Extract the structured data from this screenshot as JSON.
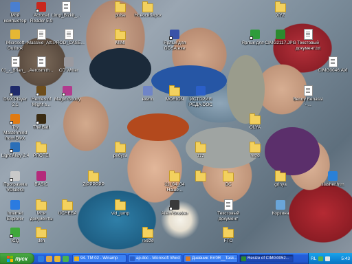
{
  "desktop": {
    "icons": [
      {
        "key": "my_computer",
        "label": "Мой компьютер",
        "kind": "app",
        "color": "#4a7fd0",
        "shortcut": false
      },
      {
        "key": "acrobat",
        "label": "Acrobat Reader 5.0",
        "kind": "app",
        "color": "#c8281e",
        "shortcut": true
      },
      {
        "key": "limp",
        "label": "Limp_Bizkit_...",
        "kind": "doc",
        "color": "#ffffff",
        "shortcut": false
      },
      {
        "key": "pulse",
        "label": "pulse",
        "kind": "folder",
        "color": "#f3d15e",
        "shortcut": false
      },
      {
        "key": "novosibirsk",
        "label": "Новосибирск",
        "kind": "folder",
        "color": "#f3d15e",
        "shortcut": false
      },
      {
        "key": "xyz",
        "label": "XYZ",
        "kind": "folder",
        "color": "#f3d15e",
        "shortcut": false
      },
      {
        "key": "outlook",
        "label": "Microsoft Outlook",
        "kind": "app",
        "color": "#e6b734",
        "shortcut": false
      },
      {
        "key": "massive",
        "label": "Massive_Att...",
        "kind": "doc",
        "color": "#ffffff",
        "shortcut": false
      },
      {
        "key": "prod2",
        "label": "PROD_CASE...",
        "kind": "doc",
        "color": "#ffffff",
        "shortcut": false
      },
      {
        "key": "mimi",
        "label": "MIMI",
        "kind": "folder",
        "color": "#f3d15e",
        "shortcut": false
      },
      {
        "key": "ddsa",
        "label": "Ярлык для DDSA.exe",
        "kind": "app",
        "color": "#3a53a8",
        "shortcut": true
      },
      {
        "key": "shortcut_rus",
        "label": "Ярлык для ...",
        "kind": "app",
        "color": "#2f9c3a",
        "shortcut": true
      },
      {
        "key": "cimg2117",
        "label": "CIMG2117.JPG",
        "kind": "app",
        "color": "#2b8a2e",
        "shortcut": false
      },
      {
        "key": "textdoc",
        "label": "Текстовый документ.txt",
        "kind": "doc",
        "color": "#ffffff",
        "shortcut": false
      },
      {
        "key": "brian",
        "label": "01_-_Brian_...",
        "kind": "doc",
        "color": "#ffffff",
        "shortcut": false
      },
      {
        "key": "aerosmith",
        "label": "Aerosmith...",
        "kind": "doc",
        "color": "#ffffff",
        "shortcut": false
      },
      {
        "key": "cdwriter",
        "label": "CD Writer",
        "kind": "app",
        "color": "#9a9aa0",
        "shortcut": false
      },
      {
        "key": "cimg0046",
        "label": "CIMG0046.AVI",
        "kind": "doc",
        "color": "#ffffff",
        "shortcut": false
      },
      {
        "key": "divxplayer",
        "label": "DivX Player 2.1",
        "kind": "app",
        "color": "#1f2a6a",
        "shortcut": true
      },
      {
        "key": "heroes",
        "label": "Heroes of Might a...",
        "kind": "app",
        "color": "#6e4e1c",
        "shortcut": true
      },
      {
        "key": "magicgoody",
        "label": "Magic Goody",
        "kind": "app",
        "color": "#b23b8e",
        "shortcut": true
      },
      {
        "key": "nkito",
        "label": "нкито",
        "kind": "app",
        "color": "#6f85c7",
        "shortcut": false
      },
      {
        "key": "morion",
        "label": "MORION",
        "kind": "folder",
        "color": "#f3d15e",
        "shortcut": false
      },
      {
        "key": "istoriya",
        "label": "ИСТОРИЯ РЕДА.DOC",
        "kind": "app",
        "color": "#2b5fc8",
        "shortcut": false
      },
      {
        "key": "benny",
        "label": "Benny Benassi - ...",
        "kind": "doc",
        "color": "#ffffff",
        "shortcut": false
      },
      {
        "key": "divx_tmm",
        "label": "Try Mastermind from DivX",
        "kind": "app",
        "color": "#e07a12",
        "shortcut": true
      },
      {
        "key": "thebat",
        "label": "The Bat!",
        "kind": "app",
        "color": "#3a2b12",
        "shortcut": true
      },
      {
        "key": "olya",
        "label": "OLYA",
        "kind": "folder",
        "color": "#f3d15e",
        "shortcut": false
      },
      {
        "key": "lightalloy",
        "label": "Light Alloy 2.4",
        "kind": "app",
        "color": "#2a6fb8",
        "shortcut": true
      },
      {
        "key": "protei",
        "label": "PROTEI",
        "kind": "folder",
        "color": "#f3d15e",
        "shortcut": false
      },
      {
        "key": "rebuha",
        "label": "ребуха",
        "kind": "folder",
        "color": "#f3d15e",
        "shortcut": false
      },
      {
        "key": "zzz",
        "label": "zzz",
        "kind": "folder",
        "color": "#f3d15e",
        "shortcut": false
      },
      {
        "key": "retro",
        "label": "retro",
        "kind": "folder",
        "color": "#f3d15e",
        "shortcut": false
      },
      {
        "key": "vdiaer",
        "label": "Программа VDialer3",
        "kind": "app",
        "color": "#c9c9c9",
        "shortcut": true
      },
      {
        "key": "basic",
        "label": "BASIC",
        "kind": "app",
        "color": "#b42a7a",
        "shortcut": false
      },
      {
        "key": "zippppp",
        "label": "ZIPPPPPP",
        "kind": "folder",
        "color": "#f3d15e",
        "shortcut": false
      },
      {
        "key": "nashe",
        "label": "11_04_04 Наше...",
        "kind": "folder",
        "color": "#f3d15e",
        "shortcut": false
      },
      {
        "key": "dasha",
        "label": "",
        "kind": "folder",
        "color": "#f3d15e",
        "shortcut": false
      },
      {
        "key": "dc",
        "label": "DC",
        "kind": "folder",
        "color": "#f3d15e",
        "shortcut": false
      },
      {
        "key": "grinya",
        "label": "grinya",
        "kind": "folder",
        "color": "#f3d15e",
        "shortcut": false
      },
      {
        "key": "slasher",
        "label": "slasher.htm",
        "kind": "app",
        "color": "#2a80d8",
        "shortcut": false
      },
      {
        "key": "ie",
        "label": "Internet Explorer",
        "kind": "app",
        "color": "#2b7be0",
        "shortcut": false
      },
      {
        "key": "mydocs",
        "label": "Мои документы",
        "kind": "folder",
        "color": "#f3d15e",
        "shortcut": false
      },
      {
        "key": "ucheba",
        "label": "UCHEBA",
        "kind": "folder",
        "color": "#f3d15e",
        "shortcut": false
      },
      {
        "key": "vidjump",
        "label": "vid_jump",
        "kind": "folder",
        "color": "#f3d15e",
        "shortcut": false
      },
      {
        "key": "alienshooter",
        "label": "Alien Shooter",
        "kind": "app",
        "color": "#3a3a3a",
        "shortcut": true
      },
      {
        "key": "textdoc2",
        "label": "Текстовый документ",
        "kind": "doc",
        "color": "#ffffff",
        "shortcut": false
      },
      {
        "key": "korzina",
        "label": "Корзина",
        "kind": "app",
        "color": "#6aa5d8",
        "shortcut": false
      },
      {
        "key": "icq",
        "label": "ICQ",
        "kind": "app",
        "color": "#3fa83a",
        "shortcut": true
      },
      {
        "key": "den",
        "label": "den",
        "kind": "folder",
        "color": "#f3d15e",
        "shortcut": false
      },
      {
        "key": "resize",
        "label": "resize",
        "kind": "folder",
        "color": "#f3d15e",
        "shortcut": false
      },
      {
        "key": "fto",
        "label": "FTO",
        "kind": "folder",
        "color": "#f3d15e",
        "shortcut": false
      }
    ]
  },
  "taskbar": {
    "start_label": "пуск",
    "quick_launch": [
      {
        "name": "ie-quicklaunch-icon",
        "color": "#2b7be0"
      },
      {
        "name": "desktop-quicklaunch-icon",
        "color": "#dba64a"
      },
      {
        "name": "outlook-quicklaunch-icon",
        "color": "#e6b734"
      },
      {
        "name": "media-quicklaunch-icon",
        "color": "#4ab24f"
      }
    ],
    "tasks": [
      {
        "label": "94. TM 02 - Winamp",
        "color": "#e9b01f",
        "active": false
      },
      {
        "label": "ap.doc - Microsoft Word",
        "color": "#2b5fc8",
        "active": false
      },
      {
        "label": "Дневник: Err0R__Task...",
        "color": "#d97b2a",
        "active": false
      },
      {
        "label": "Resize of CIMG0052...",
        "color": "#2b8a2e",
        "active": true
      }
    ],
    "tray": {
      "lang": "RL",
      "time": "5:43"
    }
  },
  "colors": {
    "taskbar_blue": "#245edb",
    "start_green": "#3c9a3a",
    "tray_blue": "#0f8ad8"
  }
}
